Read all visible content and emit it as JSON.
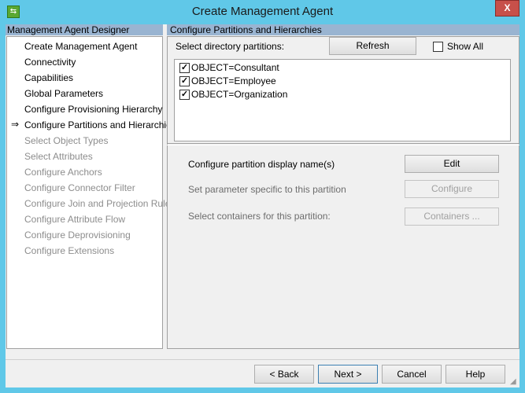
{
  "window": {
    "title": "Create Management Agent",
    "close_label": "X"
  },
  "sidebar": {
    "header": "Management Agent Designer",
    "current_marker": "⇒",
    "items": [
      {
        "label": "Create Management Agent",
        "enabled": true
      },
      {
        "label": "Connectivity",
        "enabled": true
      },
      {
        "label": "Capabilities",
        "enabled": true
      },
      {
        "label": "Global Parameters",
        "enabled": true
      },
      {
        "label": "Configure Provisioning Hierarchy",
        "enabled": true
      },
      {
        "label": "Configure Partitions and Hierarchies",
        "enabled": true,
        "current": true
      },
      {
        "label": "Select Object Types",
        "enabled": false
      },
      {
        "label": "Select Attributes",
        "enabled": false
      },
      {
        "label": "Configure Anchors",
        "enabled": false
      },
      {
        "label": "Configure Connector Filter",
        "enabled": false
      },
      {
        "label": "Configure Join and Projection Rules",
        "enabled": false
      },
      {
        "label": "Configure Attribute Flow",
        "enabled": false
      },
      {
        "label": "Configure Deprovisioning",
        "enabled": false
      },
      {
        "label": "Configure Extensions",
        "enabled": false
      }
    ]
  },
  "main": {
    "header": "Configure Partitions and Hierarchies",
    "select_label": "Select directory partitions:",
    "refresh": "Refresh",
    "show_all": "Show All",
    "show_all_checked": false,
    "partitions": [
      {
        "label": "OBJECT=Consultant",
        "checked": true
      },
      {
        "label": "OBJECT=Employee",
        "checked": true
      },
      {
        "label": "OBJECT=Organization",
        "checked": true
      }
    ],
    "display_name_label": "Configure partition display name(s)",
    "edit": "Edit",
    "param_label": "Set parameter specific to this partition",
    "configure": "Configure",
    "containers_label": "Select containers for this partition:",
    "containers": "Containers ..."
  },
  "footer": {
    "back": "< Back",
    "next": "Next >",
    "cancel": "Cancel",
    "help": "Help"
  }
}
